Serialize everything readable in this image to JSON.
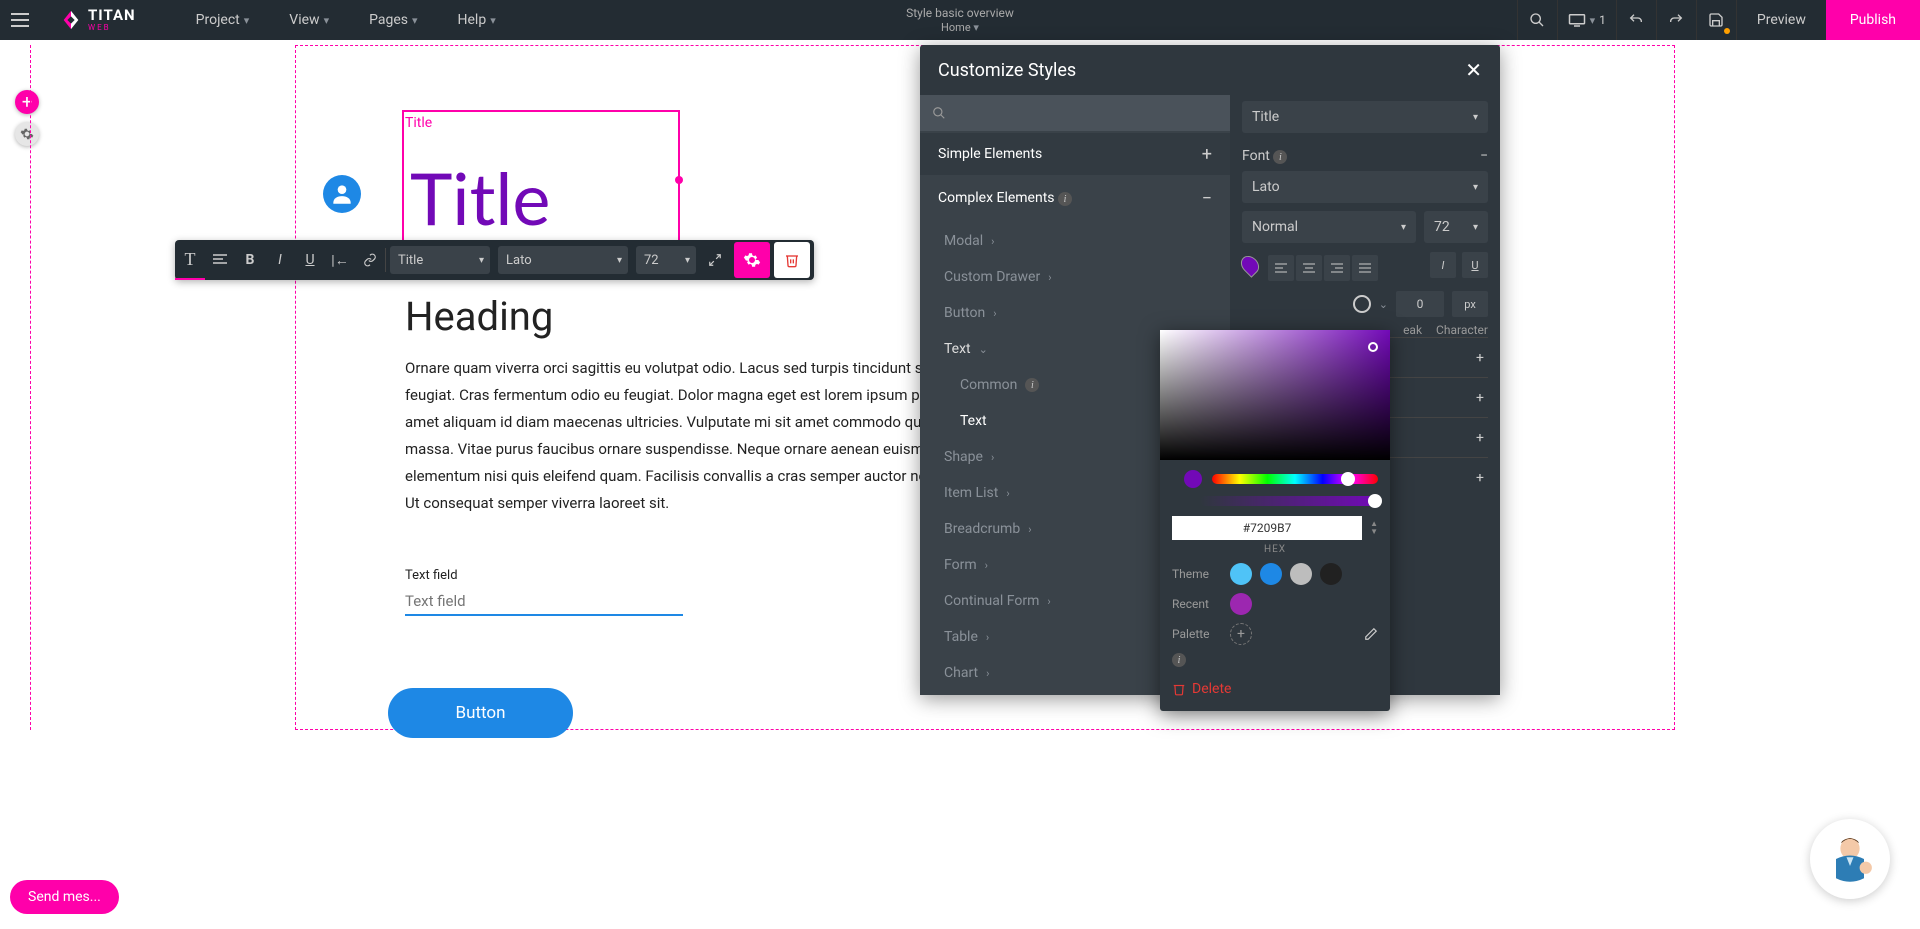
{
  "topbar": {
    "logo_text": "TITAN",
    "logo_sub": "WEB",
    "menus": [
      "Project",
      "View",
      "Pages",
      "Help"
    ],
    "doc_title": "Style basic overview",
    "doc_sub": "Home",
    "device_count": "1",
    "preview": "Preview",
    "publish": "Publish"
  },
  "canvas": {
    "title_label": "Title",
    "title_text": "Title",
    "heading": "Heading",
    "body": "Ornare quam viverra orci sagittis eu volutpat odio. Lacus sed turpis tincidunt sagittis eu feugiat. Cras fermentum odio eu feugiat. Dolor magna eget est lorem ipsum pharetra sit amet aliquam id diam maecenas ultricies. Vulputate mi sit amet commodo quis imperdiet massa. Vitae purus faucibus ornare suspendisse. Neque ornare aenean euismod elementum nisi quis eleifend quam. Facilisis convallis a cras semper auctor neque vitae. Ut consequat semper viverra laoreet sit.",
    "field_label": "Text field",
    "field_placeholder": "Text field",
    "button": "Button"
  },
  "fl_toolbar": {
    "style_select": "Title",
    "font_select": "Lato",
    "size": "72"
  },
  "panel": {
    "title": "Customize Styles",
    "left": {
      "simple": "Simple Elements",
      "complex": "Complex Elements",
      "items": [
        "Modal",
        "Custom Drawer",
        "Button",
        "Text",
        "Common",
        "Text",
        "Shape",
        "Item List",
        "Breadcrumb",
        "Form",
        "Continual Form",
        "Table",
        "Chart"
      ]
    },
    "right": {
      "target": "Title",
      "font_label": "Font",
      "font_family": "Lato",
      "font_weight": "Normal",
      "font_size": "72",
      "spacing_val": "0",
      "spacing_unit": "px",
      "line_break": "eak",
      "character": "Character",
      "rows": [
        "",
        "",
        "",
        ""
      ]
    }
  },
  "color": {
    "hex": "#7209B7",
    "hex_label": "HEX",
    "theme_label": "Theme",
    "recent_label": "Recent",
    "palette_label": "Palette",
    "delete": "Delete",
    "theme_swatches": [
      "#4fc3f7",
      "#1e88e5",
      "#bdbdbd",
      "#212121"
    ],
    "recent_swatches": [
      "#9c27b0"
    ]
  },
  "send_msg": "Send mes...",
  "chart_data": null
}
